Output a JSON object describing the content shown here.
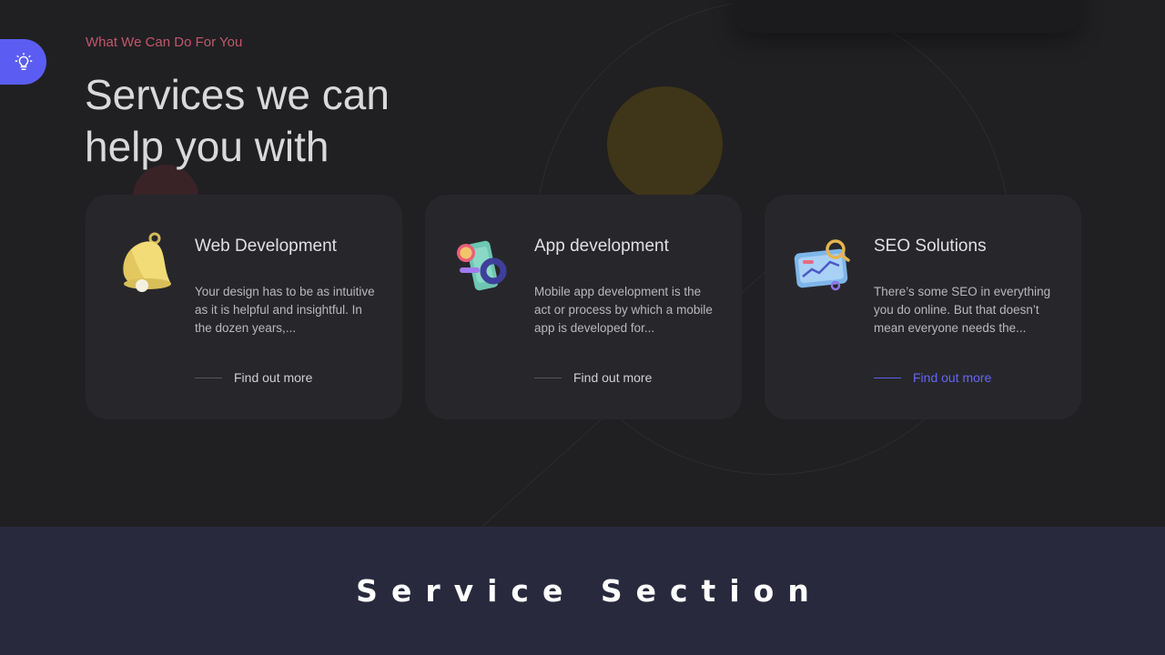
{
  "section": {
    "eyebrow": "What We Can Do For You",
    "title": "Services we can help you with"
  },
  "fab": {
    "icon": "lightbulb-icon"
  },
  "services": [
    {
      "title": "Web Development",
      "description": "Your design has to be as intuitive as it is helpful and insightful. In the dozen years,...",
      "link": "Find out more",
      "icon": "bell-icon"
    },
    {
      "title": "App development",
      "description": "Mobile app development is the act or process by which a mobile app is developed for...",
      "link": "Find out more",
      "icon": "mobile-app-icon"
    },
    {
      "title": "SEO Solutions",
      "description": "There’s some SEO in everything you do online. But that doesn’t mean everyone needs the...",
      "link": "Find out more",
      "icon": "seo-analytics-icon"
    }
  ],
  "banner": {
    "text": "Service Section"
  },
  "colors": {
    "accent": "#5b5df2",
    "eyebrow": "#c2566c",
    "background": "#202022",
    "card": "#27272b",
    "banner": "#29293e"
  }
}
